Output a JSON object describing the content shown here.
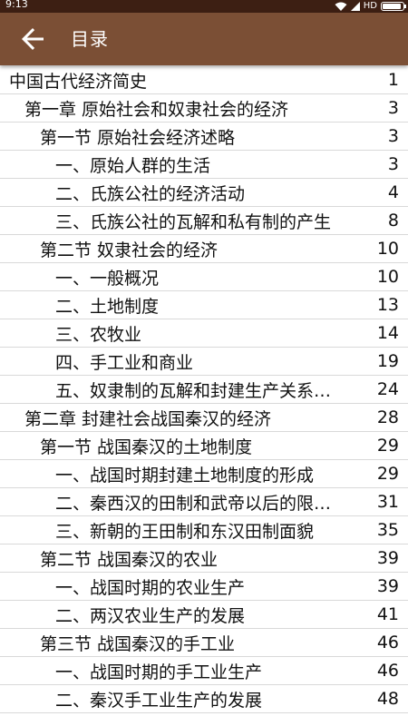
{
  "status_bar": {
    "time": "9:13",
    "network_label": "HD",
    "battery_level": 0.9
  },
  "app_bar": {
    "title": "目录",
    "back_icon": "arrow-left-icon",
    "color": "#7b4f35"
  },
  "toc": [
    {
      "level": 0,
      "title": "中国古代经济简史",
      "page": "1"
    },
    {
      "level": 1,
      "title": "第一章 原始社会和奴隶社会的经济",
      "page": "3"
    },
    {
      "level": 2,
      "title": "第一节 原始社会经济述略",
      "page": "3"
    },
    {
      "level": 3,
      "title": "一、原始人群的生活",
      "page": "3"
    },
    {
      "level": 3,
      "title": "二、氏族公社的经济活动",
      "page": "4"
    },
    {
      "level": 3,
      "title": "三、氏族公社的瓦解和私有制的产生",
      "page": "8"
    },
    {
      "level": 2,
      "title": "第二节 奴隶社会的经济",
      "page": "10"
    },
    {
      "level": 3,
      "title": "一、一般概况",
      "page": "10"
    },
    {
      "level": 3,
      "title": "二、土地制度",
      "page": "13"
    },
    {
      "level": 3,
      "title": "三、农牧业",
      "page": "14"
    },
    {
      "level": 3,
      "title": "四、手工业和商业",
      "page": "19"
    },
    {
      "level": 3,
      "title": "五、奴隶制的瓦解和封建生产关系…",
      "page": "24"
    },
    {
      "level": 1,
      "title": "第二章 封建社会战国秦汉的经济",
      "page": "28"
    },
    {
      "level": 2,
      "title": "第一节 战国秦汉的土地制度",
      "page": "29"
    },
    {
      "level": 3,
      "title": "一、战国时期封建土地制度的形成",
      "page": "29"
    },
    {
      "level": 3,
      "title": "二、秦西汉的田制和武帝以后的限…",
      "page": "31"
    },
    {
      "level": 3,
      "title": "三、新朝的王田制和东汉田制面貌",
      "page": "35"
    },
    {
      "level": 2,
      "title": "第二节 战国秦汉的农业",
      "page": "39"
    },
    {
      "level": 3,
      "title": "一、战国时期的农业生产",
      "page": "39"
    },
    {
      "level": 3,
      "title": "二、两汉农业生产的发展",
      "page": "41"
    },
    {
      "level": 2,
      "title": "第三节 战国秦汉的手工业",
      "page": "46"
    },
    {
      "level": 3,
      "title": "一、战国时期的手工业生产",
      "page": "46"
    },
    {
      "level": 3,
      "title": "二、秦汉手工业生产的发展",
      "page": "48"
    }
  ]
}
